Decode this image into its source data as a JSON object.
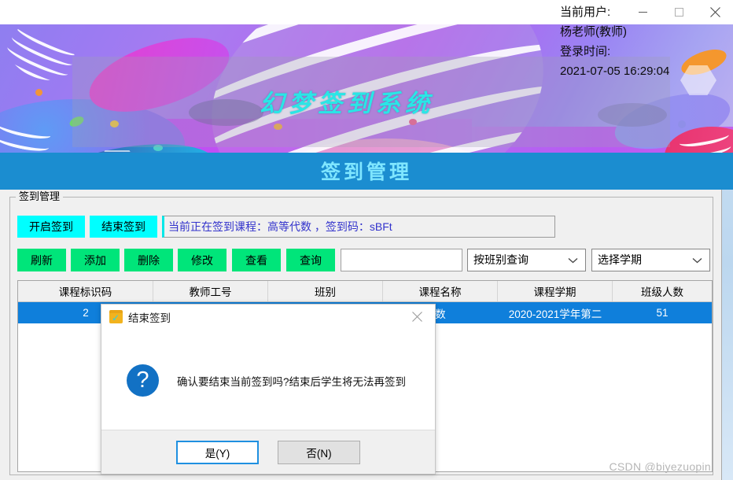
{
  "window": {
    "controls": [
      {
        "name": "minimize",
        "glyph": "minimize-icon"
      },
      {
        "name": "maximize",
        "glyph": "maximize-icon"
      },
      {
        "name": "close",
        "glyph": "close-icon"
      }
    ]
  },
  "banner": {
    "app_title": "幻梦签到系统",
    "title_color": "#2ae6e6",
    "user_label": "当前用户:",
    "user_name": "杨老师(教师)",
    "login_label": "登录时间:",
    "login_time": "2021-07-05 16:29:04"
  },
  "subheader": {
    "title": "签到管理",
    "background": "#1b8dd0",
    "text_color": "#7fe6ff"
  },
  "groupbox": {
    "label": "签到管理"
  },
  "toolbar": {
    "start_signin": "开启签到",
    "end_signin": "结束签到",
    "status_text": "当前正在签到课程：高等代数 ，签到码：sBFt",
    "cyan_color": "#00ffff",
    "green_color": "#00e57a",
    "actions": [
      {
        "label": "刷新",
        "name": "refresh"
      },
      {
        "label": "添加",
        "name": "add"
      },
      {
        "label": "删除",
        "name": "delete"
      },
      {
        "label": "修改",
        "name": "edit"
      },
      {
        "label": "查看",
        "name": "view"
      },
      {
        "label": "查询",
        "name": "query"
      }
    ],
    "search_value": "",
    "search_placeholder": "",
    "filter_class": "按班别查询",
    "filter_term": "选择学期"
  },
  "table": {
    "headers": [
      "课程标识码",
      "教师工号",
      "班别",
      "课程名称",
      "课程学期",
      "班级人数"
    ],
    "rows": [
      {
        "course_id": "2",
        "teacher_id": "",
        "class": "",
        "course_name": "数",
        "term": "2020-2021学年第二",
        "class_size": "51",
        "selected": true
      }
    ],
    "selected_color": "#0f7fdb"
  },
  "dialog": {
    "title": "结束签到",
    "icon": "calendar-check-icon",
    "close_glyph": "close-icon",
    "message_icon": "question-icon",
    "message": "确认要结束当前签到吗?结束后学生将无法再签到",
    "yes_label": "是(Y)",
    "no_label": "否(N)",
    "yes_focused": true
  },
  "watermark": {
    "text": "CSDN @biyezuopin"
  }
}
